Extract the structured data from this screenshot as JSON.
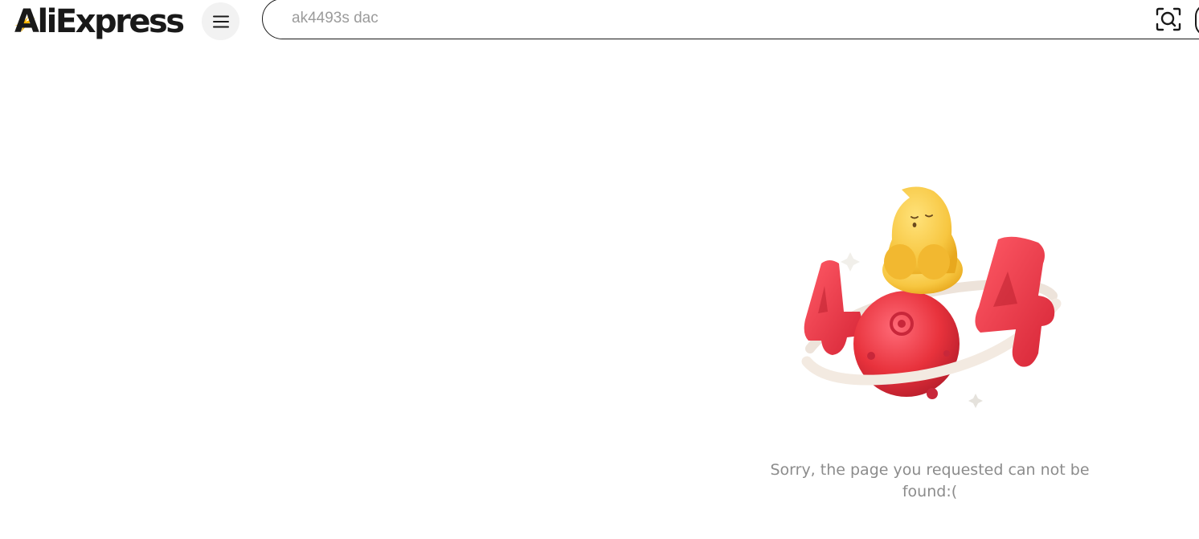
{
  "header": {
    "logo_text": "AliExpress",
    "menu_icon": "hamburger-menu-icon",
    "search": {
      "placeholder": "ak4493s dac",
      "value": ""
    },
    "camera_icon": "image-search-camera-icon"
  },
  "main": {
    "illustration_icon": "404-planet-mascot-illustration",
    "error_message": "Sorry, the page you requested can not be found:("
  },
  "colors": {
    "brand_black": "#191919",
    "brand_yellow": "#F7B500",
    "error_red": "#E8323C",
    "muted_text": "#8C8C8C"
  }
}
